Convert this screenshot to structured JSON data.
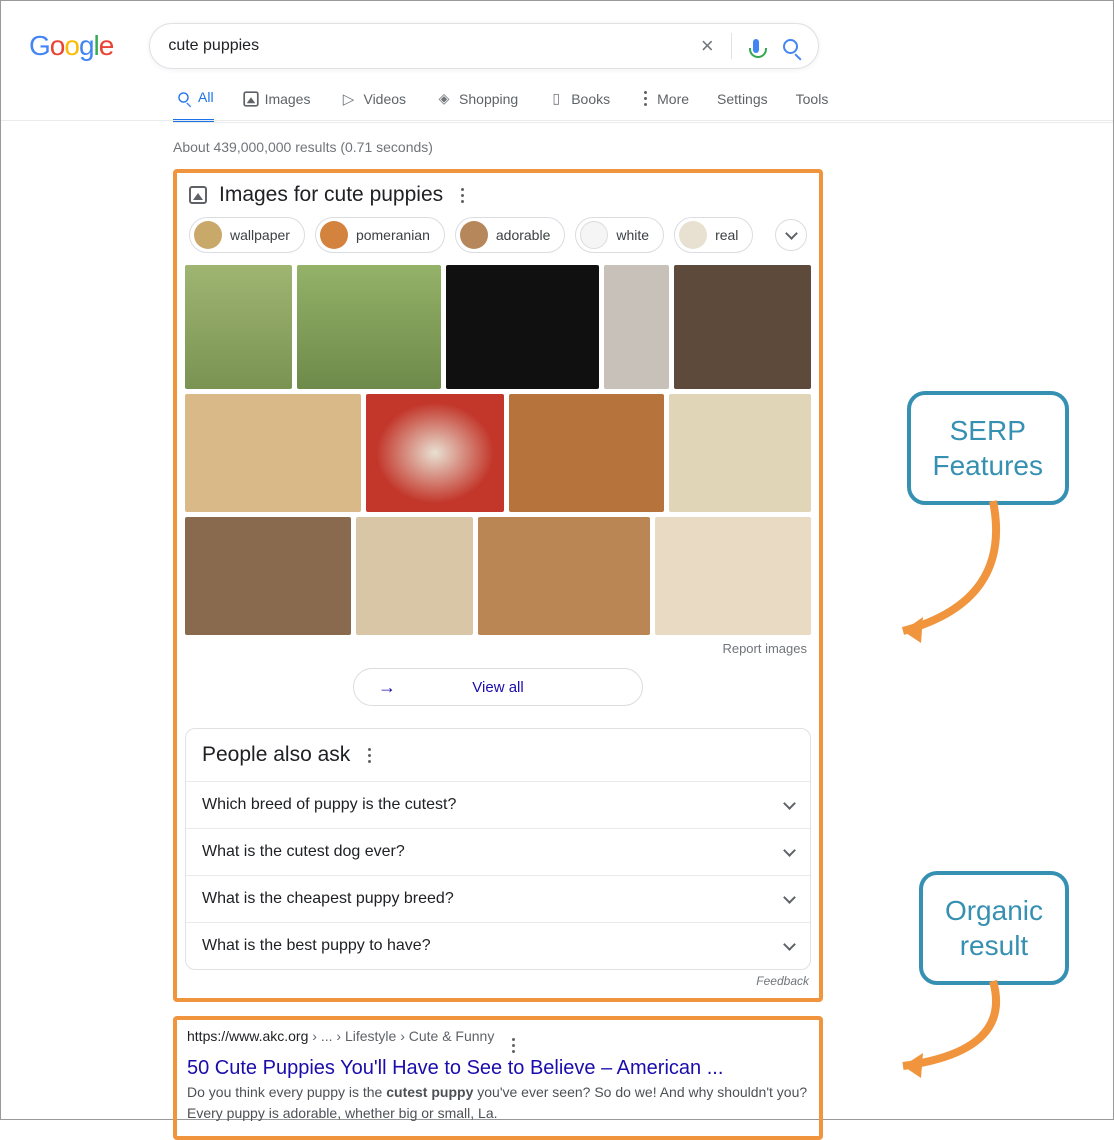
{
  "logo_letters": [
    "G",
    "o",
    "o",
    "g",
    "l",
    "e"
  ],
  "search": {
    "query": "cute puppies"
  },
  "tabs": {
    "all": "All",
    "images": "Images",
    "videos": "Videos",
    "shopping": "Shopping",
    "books": "Books",
    "more": "More",
    "settings": "Settings",
    "tools": "Tools"
  },
  "stats": "About 439,000,000 results (0.71 seconds)",
  "images_block": {
    "heading": "Images for cute puppies",
    "chips": {
      "wallpaper": "wallpaper",
      "pomeranian": "pomeranian",
      "adorable": "adorable",
      "white": "white",
      "real": "real"
    },
    "report": "Report images",
    "view_all": "View all"
  },
  "paa": {
    "heading": "People also ask",
    "q1": "Which breed of puppy is the cutest?",
    "q2": "What is the cutest dog ever?",
    "q3": "What is the cheapest puppy breed?",
    "q4": "What is the best puppy to have?",
    "feedback": "Feedback"
  },
  "organic": {
    "url": "https://www.akc.org",
    "breadcrumb": " › ... › Lifestyle › Cute & Funny",
    "title": "50 Cute Puppies You'll Have to See to Believe – American ...",
    "snip_pre": "Do you think every puppy is the ",
    "snip_bold": "cutest puppy",
    "snip_post": " you've ever seen? So do we! And why shouldn't you? Every puppy is adorable, whether big or small, La."
  },
  "callouts": {
    "serp": "SERP Features",
    "organic": "Organic result"
  }
}
